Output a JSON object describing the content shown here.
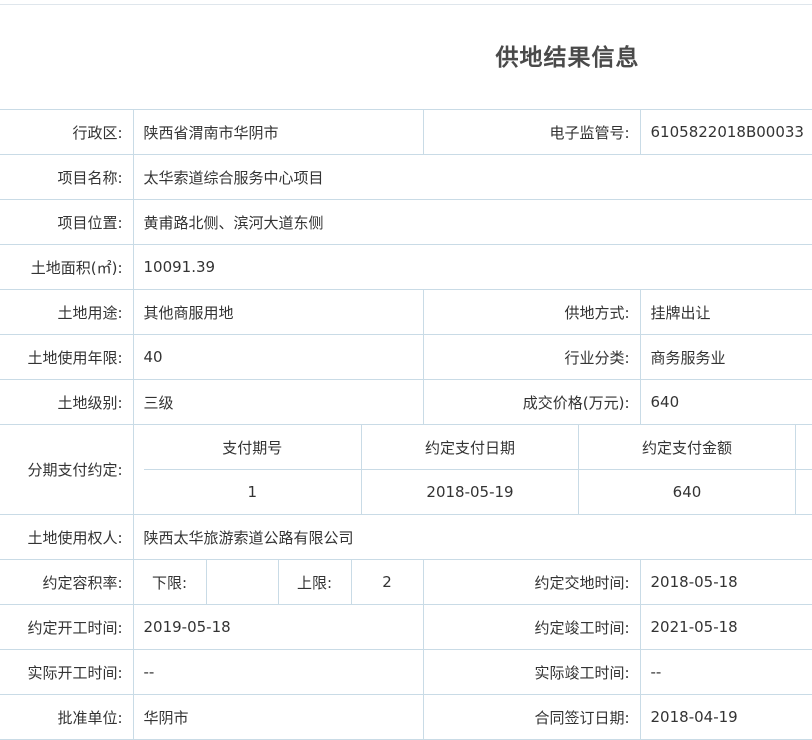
{
  "title": "供地结果信息",
  "rows": {
    "region": {
      "label": "行政区:",
      "value": "陕西省渭南市华阴市"
    },
    "supervision_no": {
      "label": "电子监管号:",
      "value": "6105822018B00033"
    },
    "project_name": {
      "label": "项目名称:",
      "value": "太华索道综合服务中心项目"
    },
    "project_location": {
      "label": "项目位置:",
      "value": "黄甫路北侧、滨河大道东侧"
    },
    "land_area": {
      "label": "土地面积(㎡):",
      "value": "10091.39"
    },
    "land_use": {
      "label": "土地用途:",
      "value": "其他商服用地"
    },
    "supply_method": {
      "label": "供地方式:",
      "value": "挂牌出让"
    },
    "use_term": {
      "label": "土地使用年限:",
      "value": "40"
    },
    "industry": {
      "label": "行业分类:",
      "value": "商务服务业"
    },
    "land_grade": {
      "label": "土地级别:",
      "value": "三级"
    },
    "deal_price": {
      "label": "成交价格(万元):",
      "value": "640"
    },
    "installment": {
      "label": "分期支付约定:",
      "headers": [
        "支付期号",
        "约定支付日期",
        "约定支付金额"
      ],
      "items": [
        {
          "no": "1",
          "date": "2018-05-19",
          "amount": "640"
        }
      ]
    },
    "land_user": {
      "label": "土地使用权人:",
      "value": "陕西太华旅游索道公路有限公司"
    },
    "far": {
      "label": "约定容积率:",
      "lower_label": "下限:",
      "lower_value": "",
      "upper_label": "上限:",
      "upper_value": "2"
    },
    "handover_time": {
      "label": "约定交地时间:",
      "value": "2018-05-18"
    },
    "planned_start": {
      "label": "约定开工时间:",
      "value": "2019-05-18"
    },
    "planned_completion": {
      "label": "约定竣工时间:",
      "value": "2021-05-18"
    },
    "actual_start": {
      "label": "实际开工时间:",
      "value": "--"
    },
    "actual_completion": {
      "label": "实际竣工时间:",
      "value": "--"
    },
    "approval_unit": {
      "label": "批准单位:",
      "value": "华阴市"
    },
    "contract_date": {
      "label": "合同签订日期:",
      "value": "2018-04-19"
    }
  }
}
